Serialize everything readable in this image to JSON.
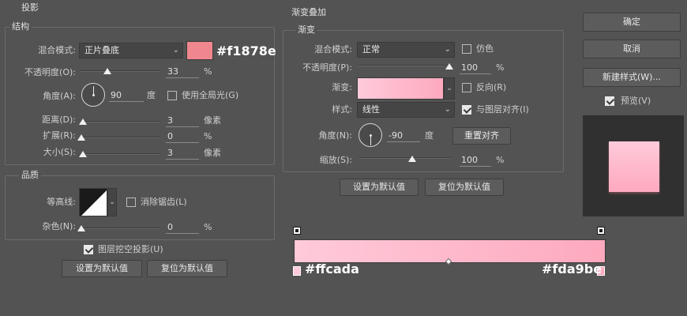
{
  "colors": {
    "shadow_swatch": "#f1878e",
    "gradient_start": "#ffcada",
    "gradient_end": "#fda9be",
    "panel_bg": "#535353"
  },
  "shadow": {
    "section_title": "投影",
    "structure": {
      "title": "结构",
      "blend_mode_label": "混合模式:",
      "blend_mode_value": "正片叠底",
      "swatch_hex": "#f1878e",
      "opacity_label": "不透明度(O):",
      "opacity_value": "33",
      "opacity_unit": "%",
      "angle_label": "角度(A):",
      "angle_value": "90",
      "angle_unit": "度",
      "global_light_label": "使用全局光(G)",
      "distance_label": "距离(D):",
      "distance_value": "3",
      "distance_unit": "像素",
      "spread_label": "扩展(R):",
      "spread_value": "0",
      "spread_unit": "%",
      "size_label": "大小(S):",
      "size_value": "3",
      "size_unit": "像素"
    },
    "quality": {
      "title": "品质",
      "contour_label": "等高线:",
      "antialias_label": "消除锯齿(L)",
      "noise_label": "杂色(N):",
      "noise_value": "0",
      "noise_unit": "%"
    },
    "knockout_label": "图层挖空投影(U)",
    "set_default_label": "设置为默认值",
    "reset_default_label": "复位为默认值"
  },
  "gradient_overlay": {
    "section_title": "渐变叠加",
    "group_title": "渐变",
    "blend_mode_label": "混合模式:",
    "blend_mode_value": "正常",
    "dither_label": "仿色",
    "opacity_label": "不透明度(P):",
    "opacity_value": "100",
    "opacity_unit": "%",
    "gradient_label": "渐变:",
    "reverse_label": "反向(R)",
    "style_label": "样式:",
    "style_value": "线性",
    "align_label": "与图层对齐(I)",
    "angle_label": "角度(N):",
    "angle_value": "-90",
    "angle_unit": "度",
    "reset_align_label": "重置对齐",
    "scale_label": "缩放(S):",
    "scale_value": "100",
    "scale_unit": "%",
    "set_default_label": "设置为默认值",
    "reset_default_label": "复位为默认值"
  },
  "gradient_bar": {
    "start_hex": "#ffcada",
    "end_hex": "#fda9be"
  },
  "buttons": {
    "ok": "确定",
    "cancel": "取消",
    "new_style": "新建样式(W)...",
    "preview_label": "预览(V)"
  },
  "states": {
    "global_light": false,
    "antialias": false,
    "knockout": true,
    "dither": false,
    "reverse": false,
    "align_with_layer": true,
    "preview": true,
    "shadow_opacity": 0.33,
    "distance_fraction": 0.03,
    "spread_fraction": 0.0,
    "size_fraction": 0.03,
    "noise_fraction": 0.0,
    "gradient_opacity": 1.0,
    "scale_fraction": 0.5
  }
}
